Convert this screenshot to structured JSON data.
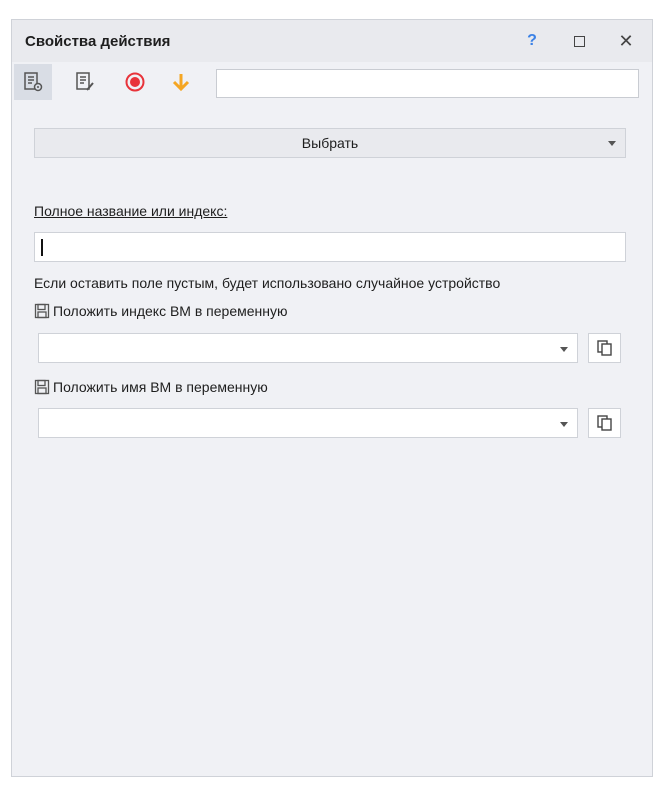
{
  "window": {
    "title": "Свойства действия",
    "help_glyph": "?",
    "close_glyph": "✕"
  },
  "toolbar": {
    "tools": [
      "settings-doc-icon",
      "edit-doc-icon",
      "record-icon",
      "arrow-down-icon"
    ],
    "input_value": ""
  },
  "main": {
    "select_label": "Выбрать",
    "name_label": "Полное название или индекс:",
    "name_value": "",
    "hint": "Если оставить поле пустым, будет использовано случайное устройство",
    "index_var_label": "Положить индекс ВМ в переменную",
    "index_var_value": "",
    "name_var_label": "Положить имя ВМ в переменную",
    "name_var_value": ""
  },
  "colors": {
    "accent_blue": "#3c82e6",
    "record_red": "#e8333a",
    "arrow_orange": "#f5a623",
    "panel_bg": "#f0f1f5"
  }
}
